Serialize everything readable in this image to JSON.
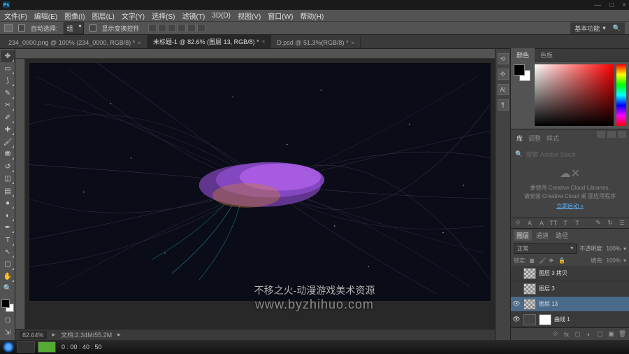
{
  "title": "Ps",
  "window_controls": {
    "min": "—",
    "max": "□",
    "close": "×"
  },
  "menu": [
    "文件(F)",
    "编辑(E)",
    "图像(I)",
    "图层(L)",
    "文字(Y)",
    "选择(S)",
    "滤镜(T)",
    "3D(D)",
    "视图(V)",
    "窗口(W)",
    "帮助(H)"
  ],
  "options": {
    "auto_select": "自动选择:",
    "group": "组",
    "show_transform": "显示变换控件",
    "workspace": "基本功能"
  },
  "tabs": [
    {
      "label": "234_0000.png @ 100% (234_0000, RGB/8) *",
      "active": false
    },
    {
      "label": "未标题-1 @ 82.6% (图层 13, RGB/8) *",
      "active": true
    },
    {
      "label": "D.psd @ 51.3%(RGB/8) *",
      "active": false
    }
  ],
  "status": {
    "zoom": "82.64%",
    "doc": "文档:2.34M/55.2M"
  },
  "panels": {
    "color_tabs": [
      "颜色",
      "色板"
    ],
    "lib_tabs": [
      "库",
      "调整",
      "样式"
    ],
    "lib_search": "搜索 Adobe Stock",
    "lib_msg1": "要使用 Creative Cloud Libraries,",
    "lib_msg2": "请安装 Creative Cloud 桌 面应用程序",
    "lib_link": "立即启动 »",
    "layer_tabs": [
      "图层",
      "通道",
      "路径"
    ],
    "blend_mode": "正常",
    "opacity_label": "不透明度:",
    "opacity": "100%",
    "lock_label": "锁定:",
    "fill_label": "填充:",
    "fill": "100%"
  },
  "layers": [
    {
      "name": "图层 3 拷贝",
      "eye": "",
      "sel": false
    },
    {
      "name": "图层 3",
      "eye": "",
      "sel": false
    },
    {
      "name": "图层 13",
      "eye": "👁",
      "sel": true
    },
    {
      "name": "曲线 1",
      "eye": "👁",
      "sel": false,
      "adj": true
    }
  ],
  "taskbar": {
    "time": "0 : 00 : 40 : 50"
  },
  "watermark": {
    "line1": "不移之火-动漫游戏美术资源",
    "line2": "www.byzhihuo.com"
  },
  "chart_data": null
}
